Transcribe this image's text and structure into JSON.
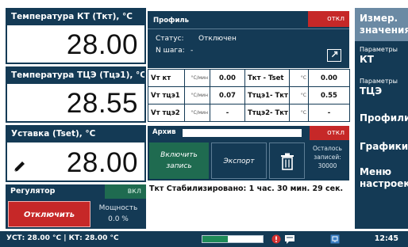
{
  "panels": {
    "kt": {
      "title": "Температура КТ (Ткт), °C",
      "value": "28.00"
    },
    "tcz": {
      "title": "Температура ТЦЭ (Тцэ1), °C",
      "value": "28.55"
    },
    "setpoint": {
      "title": "Уставка (Tset), °C",
      "value": "28.00"
    }
  },
  "regulator": {
    "title": "Регулятор",
    "state": "вкл",
    "button": "Отключить",
    "power_label": "Мощность",
    "power_value": "0.0 %"
  },
  "profile": {
    "title": "Профиль",
    "state": "откл",
    "status_label": "Статус:",
    "status_value": "Отключен",
    "step_label": "N шага:",
    "step_value": "-"
  },
  "table": {
    "rows": [
      {
        "name": "Vт кт",
        "unit": "°C/мин",
        "value": "0.00",
        "name2": "Ткт - Tset",
        "unit2": "°C",
        "value2": "0.00"
      },
      {
        "name": "Vт тцэ1",
        "unit": "°C/мин",
        "value": "0.07",
        "name2": "Ттцэ1- Ткт",
        "unit2": "°C",
        "value2": "0.55"
      },
      {
        "name": "Vт тцэ2",
        "unit": "°C/мин",
        "value": "-",
        "name2": "Ттцэ2- Ткт",
        "unit2": "°C",
        "value2": "-"
      }
    ]
  },
  "archive": {
    "title": "Архив",
    "state": "откл",
    "record_line1": "Включить",
    "record_line2": "запись",
    "export": "Экспорт",
    "remaining_line1": "Осталось",
    "remaining_line2": "записей:",
    "remaining_value": "30000"
  },
  "stabilized": "Ткт  Стабилизировано: 1 час. 30 мин. 29 сек.",
  "menu": {
    "items": [
      {
        "small": "",
        "big": "Измер.",
        "big2": "значения"
      },
      {
        "small": "Параметры",
        "big": "КТ"
      },
      {
        "small": "Параметры",
        "big": "ТЦЭ"
      },
      {
        "small": "",
        "big": "Профили"
      },
      {
        "small": "",
        "big": "Графики"
      },
      {
        "small": "",
        "big": "Меню",
        "big2": "настроек"
      }
    ]
  },
  "status": {
    "text": "УСТ: 28.00 °C | КТ: 28.00 °C",
    "progress": 0.42,
    "time": "12:45"
  },
  "colors": {
    "navy": "#143a55",
    "red": "#c62828",
    "green": "#1f6b50",
    "menu_active": "#6b8aa4"
  }
}
